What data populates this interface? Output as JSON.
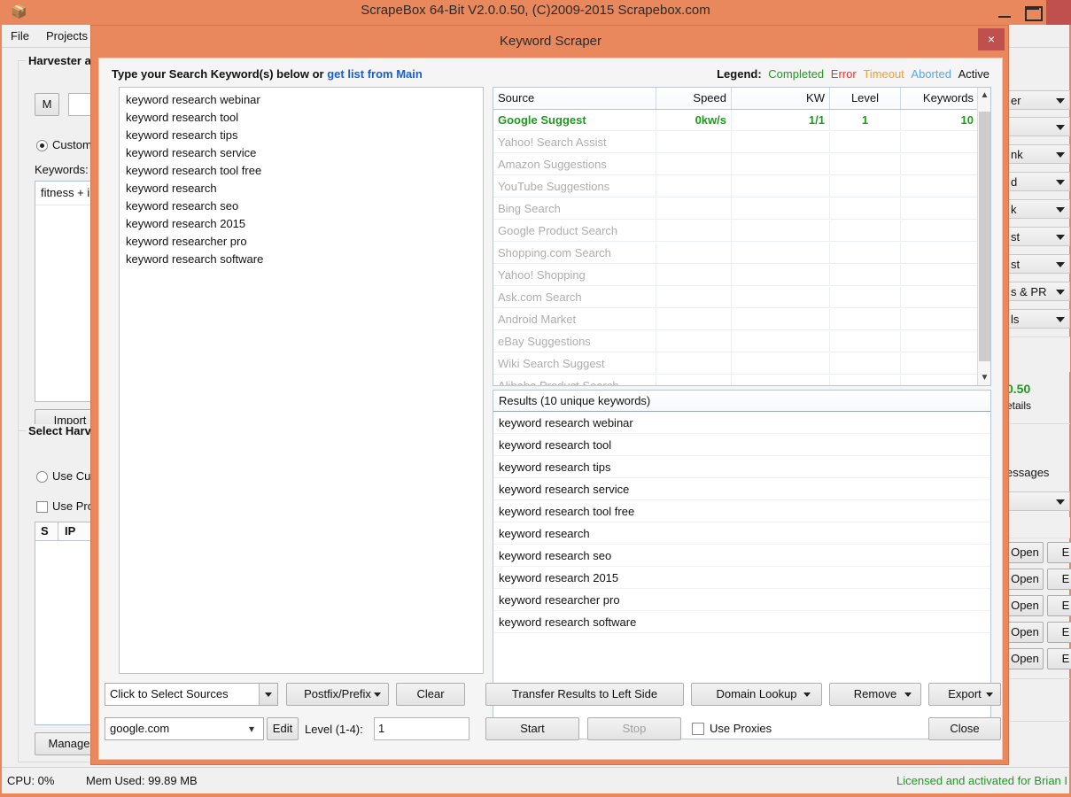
{
  "app": {
    "title": "ScrapeBox 64-Bit V2.0.0.50, (C)2009-2015 Scrapebox.com",
    "icon": "box-icon",
    "window_controls": {
      "minimize": "minimize-icon",
      "maximize": "maximize-icon",
      "close": "close-icon"
    },
    "menu": [
      {
        "label": "File"
      },
      {
        "label": "Projects"
      }
    ],
    "harvester_group_title": "Harvester a",
    "m_button": "M",
    "custom_radio_label": "Custom",
    "keywords_label": "Keywords:",
    "keywords_first_line": "fitness + i",
    "import_button": "Import",
    "select_harvester_group_title": "Select Harv",
    "use_custom_radio_label": "Use Cu",
    "use_proxies_checkbox_label": "Use Pro",
    "proxy_table_headers": [
      "S",
      "IP"
    ],
    "manage_button": "Manage",
    "right_combos": [
      "er",
      "",
      "nk",
      "d",
      "k",
      "st",
      "st",
      "s & PR",
      "ls"
    ],
    "right_price": "0.50",
    "right_details": "etails",
    "right_messages": "essages",
    "open_buttons": [
      "Open",
      "Open",
      "Open",
      "Open",
      "Open"
    ],
    "statusbar": {
      "cpu": "CPU: 0%",
      "mem": "Mem Used: 99.89 MB",
      "license": "Licensed and activated for Brian I"
    }
  },
  "dialog": {
    "title": "Keyword Scraper",
    "close_label": "×",
    "hint_prefix": "Type your Search Keyword(s) below or ",
    "hint_link": "get list from Main",
    "legend": {
      "title": "Legend:",
      "items": [
        {
          "label": "Completed",
          "color": "#1d9b1d"
        },
        {
          "label": "Error",
          "color": "#ff2a2a"
        },
        {
          "label": "Timeout",
          "color": "#f0a030"
        },
        {
          "label": "Aborted",
          "color": "#53a8e8"
        },
        {
          "label": "Active",
          "color": "#111111"
        }
      ]
    },
    "keyword_input_lines": [
      "keyword research webinar",
      "keyword research tool",
      "keyword research tips",
      "keyword research service",
      "keyword research tool free",
      "keyword research",
      "keyword research seo",
      "keyword research 2015",
      "keyword researcher pro",
      "keyword research software"
    ],
    "source_table": {
      "columns": [
        "Source",
        "Speed",
        "KW",
        "Level",
        "Keywords"
      ],
      "scroll_up_icon": "chevron-up-icon",
      "scroll_down_icon": "chevron-down-icon",
      "rows": [
        {
          "source": "Google Suggest",
          "speed": "0kw/s",
          "kw": "1/1",
          "level": "1",
          "keywords": "10",
          "state": "completed"
        },
        {
          "source": "Yahoo! Search Assist",
          "speed": "",
          "kw": "",
          "level": "",
          "keywords": "",
          "state": "idle"
        },
        {
          "source": "Amazon Suggestions",
          "speed": "",
          "kw": "",
          "level": "",
          "keywords": "",
          "state": "idle"
        },
        {
          "source": "YouTube Suggestions",
          "speed": "",
          "kw": "",
          "level": "",
          "keywords": "",
          "state": "idle"
        },
        {
          "source": "Bing Search",
          "speed": "",
          "kw": "",
          "level": "",
          "keywords": "",
          "state": "idle"
        },
        {
          "source": "Google Product Search",
          "speed": "",
          "kw": "",
          "level": "",
          "keywords": "",
          "state": "idle"
        },
        {
          "source": "Shopping.com Search",
          "speed": "",
          "kw": "",
          "level": "",
          "keywords": "",
          "state": "idle"
        },
        {
          "source": "Yahoo! Shopping",
          "speed": "",
          "kw": "",
          "level": "",
          "keywords": "",
          "state": "idle"
        },
        {
          "source": "Ask.com Search",
          "speed": "",
          "kw": "",
          "level": "",
          "keywords": "",
          "state": "idle"
        },
        {
          "source": "Android Market",
          "speed": "",
          "kw": "",
          "level": "",
          "keywords": "",
          "state": "idle"
        },
        {
          "source": "eBay Suggestions",
          "speed": "",
          "kw": "",
          "level": "",
          "keywords": "",
          "state": "idle"
        },
        {
          "source": "Wiki Search Suggest",
          "speed": "",
          "kw": "",
          "level": "",
          "keywords": "",
          "state": "idle"
        },
        {
          "source": "Alibaba Product Search",
          "speed": "",
          "kw": "",
          "level": "",
          "keywords": "",
          "state": "idle"
        }
      ]
    },
    "results": {
      "header": "Results (10 unique keywords)",
      "count": 10,
      "rows": [
        "keyword research webinar",
        "keyword research tool",
        "keyword research tips",
        "keyword research service",
        "keyword research tool free",
        "keyword research",
        "keyword research seo",
        "keyword research 2015",
        "keyword researcher pro",
        "keyword research software"
      ]
    },
    "controls": {
      "select_sources_value": "Click to Select Sources",
      "postfix_prefix_label": "Postfix/Prefix",
      "clear_label": "Clear",
      "transfer_label": "Transfer Results to Left Side",
      "domain_lookup_label": "Domain Lookup",
      "remove_label": "Remove",
      "export_label": "Export",
      "engine_value": "google.com",
      "edit_label": "Edit",
      "level_label": "Level (1-4):",
      "level_value": "1",
      "start_label": "Start",
      "stop_label": "Stop",
      "use_proxies_label": "Use Proxies",
      "close_label": "Close"
    }
  }
}
